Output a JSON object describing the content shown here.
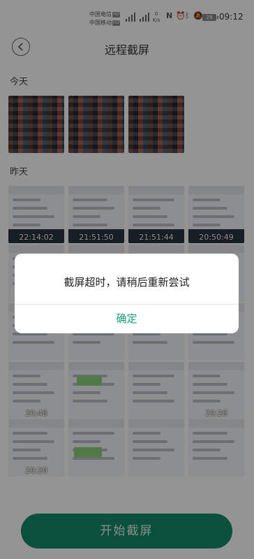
{
  "status_bar": {
    "carrier1": "中国电信",
    "carrier2": "中国移动",
    "hd_badge": "HD",
    "net_label_top": "4G",
    "speed_value": "0",
    "speed_unit": "K/s",
    "battery": "29",
    "time": "09:12",
    "icons": [
      "nfc-icon",
      "alarm-icon",
      "bluetooth-icon",
      "mute-icon"
    ]
  },
  "header": {
    "title": "远程截屏",
    "back_icon": "back-icon"
  },
  "sections": {
    "today": {
      "label": "今天",
      "items": [
        {
          "time": "",
          "kind": "photo"
        },
        {
          "time": "",
          "kind": "photo"
        },
        {
          "time": "",
          "kind": "photo"
        }
      ]
    },
    "yesterday": {
      "label": "昨天",
      "rows": [
        [
          "22:14:02",
          "21:51:50",
          "21:51:44",
          "20:50:49"
        ],
        [
          "",
          "",
          "",
          ""
        ],
        [
          "",
          "",
          "",
          ""
        ],
        [
          "20:48",
          "",
          "",
          "20:28"
        ],
        [
          "20:20",
          "",
          "",
          ""
        ]
      ]
    }
  },
  "dialog": {
    "message": "截屏超时，请稍后重新尝试",
    "confirm": "确定"
  },
  "start_button": {
    "label": "开始截屏"
  },
  "colors": {
    "accent": "#1a9b7b",
    "button": "#128a66"
  }
}
